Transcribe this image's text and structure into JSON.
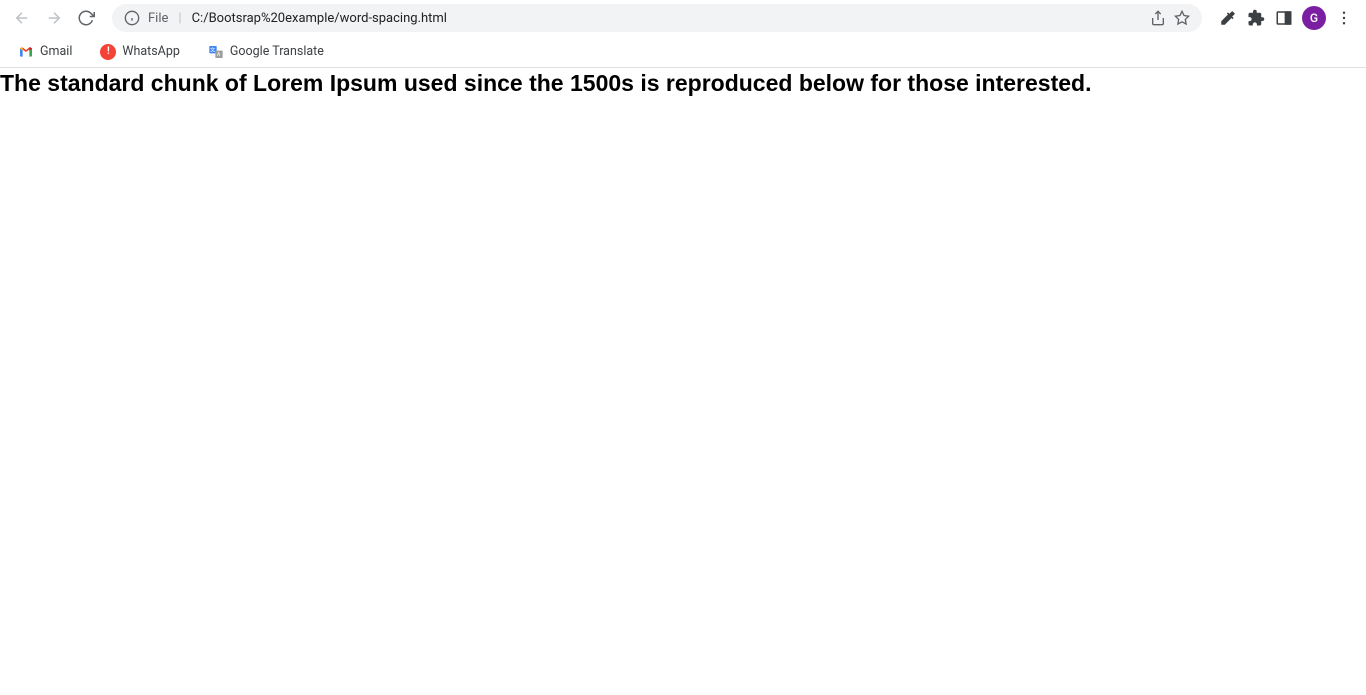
{
  "browser": {
    "url_prefix": "File",
    "url": "C:/Bootsrap%20example/word-spacing.html",
    "profile_initial": "G"
  },
  "bookmarks": {
    "gmail": "Gmail",
    "whatsapp": "WhatsApp",
    "gtranslate": "Google Translate"
  },
  "page": {
    "body_text": "The standard chunk of Lorem Ipsum used since the 1500s is reproduced below for those interested."
  }
}
